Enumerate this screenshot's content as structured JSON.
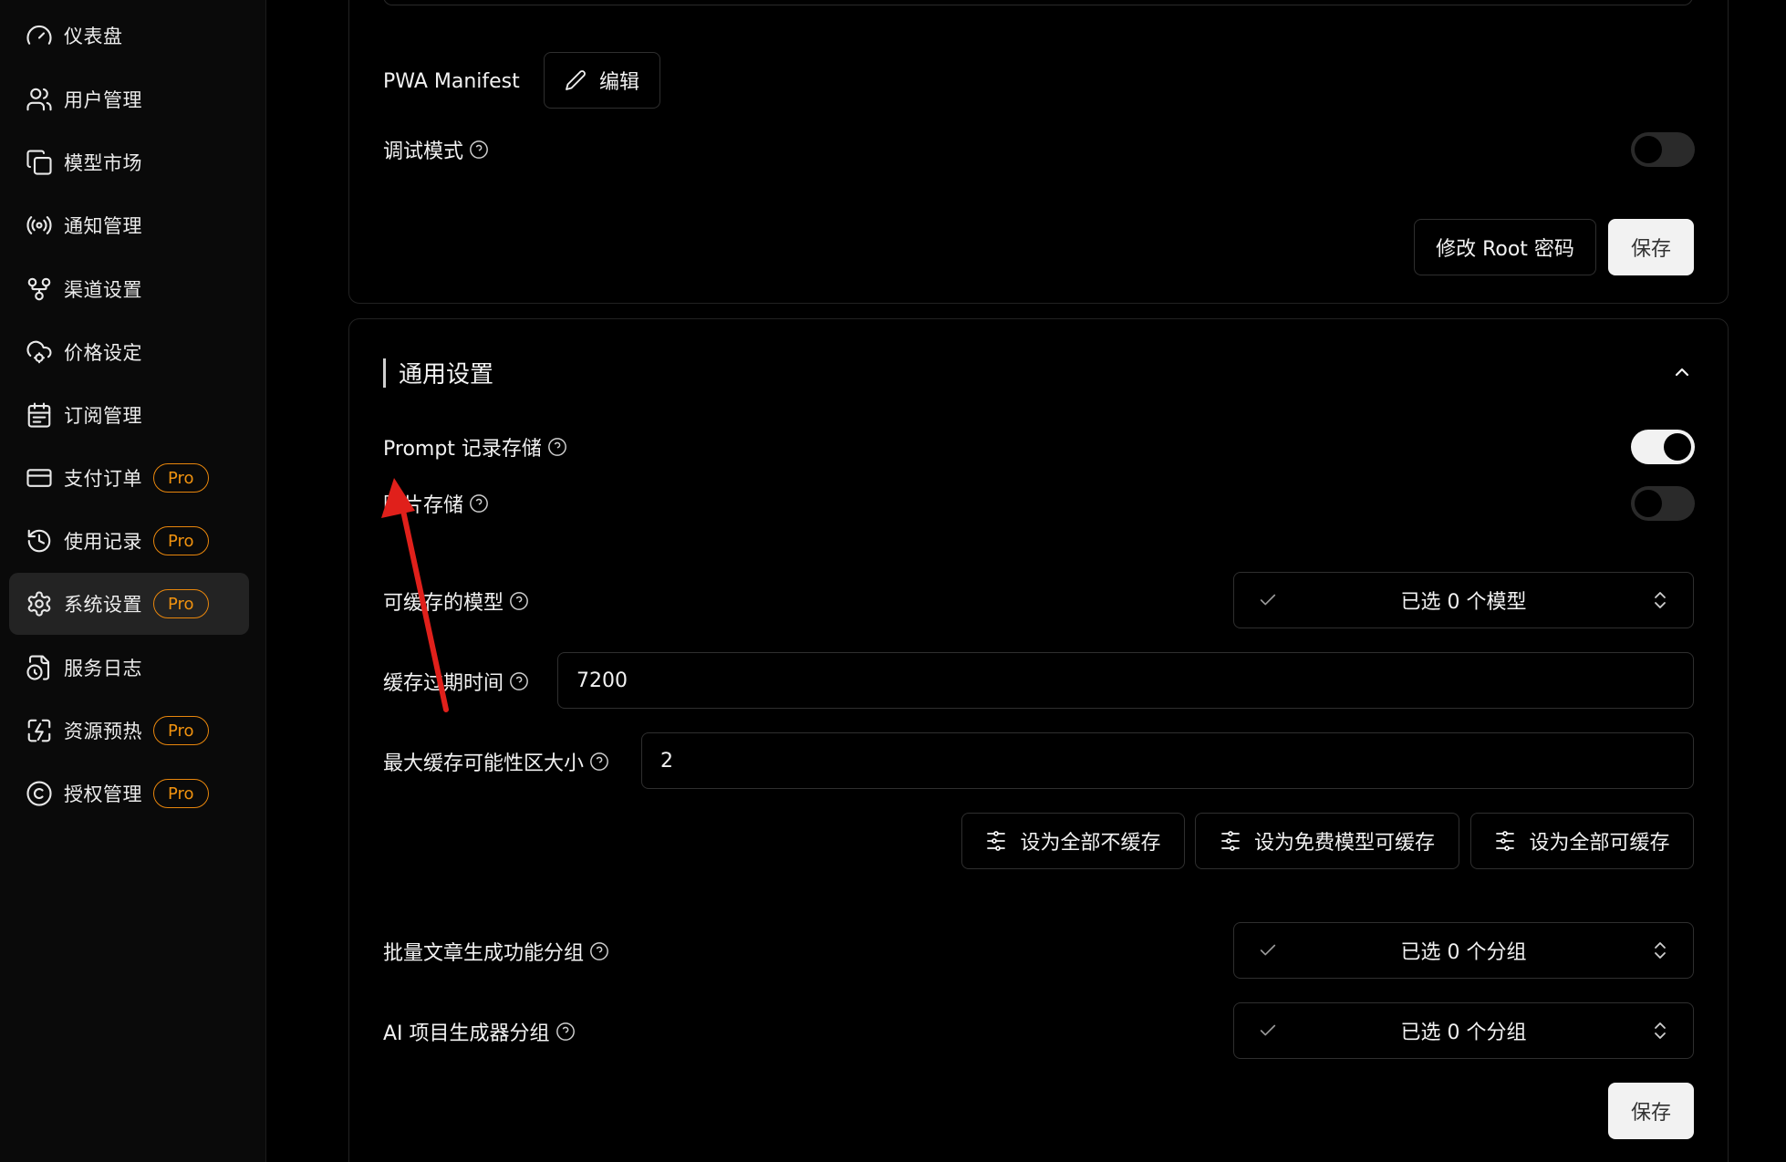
{
  "sidebar": {
    "items": [
      {
        "label": "仪表盘",
        "icon": "gauge-icon",
        "pro": false,
        "active": false
      },
      {
        "label": "用户管理",
        "icon": "users-icon",
        "pro": false,
        "active": false
      },
      {
        "label": "模型市场",
        "icon": "copy-icon",
        "pro": false,
        "active": false
      },
      {
        "label": "通知管理",
        "icon": "radio-icon",
        "pro": false,
        "active": false
      },
      {
        "label": "渠道设置",
        "icon": "git-fork-icon",
        "pro": false,
        "active": false
      },
      {
        "label": "价格设定",
        "icon": "cloud-cog-icon",
        "pro": false,
        "active": false
      },
      {
        "label": "订阅管理",
        "icon": "calendar-icon",
        "pro": false,
        "active": false
      },
      {
        "label": "支付订单",
        "icon": "credit-card-icon",
        "pro": true,
        "active": false
      },
      {
        "label": "使用记录",
        "icon": "history-icon",
        "pro": true,
        "active": false
      },
      {
        "label": "系统设置",
        "icon": "settings-icon",
        "pro": true,
        "active": true
      },
      {
        "label": "服务日志",
        "icon": "file-clock-icon",
        "pro": false,
        "active": false
      },
      {
        "label": "资源预热",
        "icon": "zap-box-icon",
        "pro": true,
        "active": false
      },
      {
        "label": "授权管理",
        "icon": "copyright-icon",
        "pro": true,
        "active": false
      }
    ],
    "pro_label": "Pro"
  },
  "top_card": {
    "pwa_label": "PWA Manifest",
    "edit_label": "编辑",
    "debug_label": "调试模式",
    "debug_on": false,
    "change_root_label": "修改 Root 密码",
    "save_label": "保存"
  },
  "general": {
    "title": "通用设置",
    "prompt_storage_label": "Prompt 记录存储",
    "prompt_storage_on": true,
    "image_storage_label": "图片存储",
    "image_storage_on": false,
    "cacheable_models_label": "可缓存的模型",
    "cacheable_models_value": "已选 0 个模型",
    "cache_ttl_label": "缓存过期时间",
    "cache_ttl_value": "7200",
    "max_cache_label": "最大缓存可能性区大小",
    "max_cache_value": "2",
    "set_none_label": "设为全部不缓存",
    "set_free_label": "设为免费模型可缓存",
    "set_all_label": "设为全部可缓存",
    "batch_group_label": "批量文章生成功能分组",
    "batch_group_value": "已选 0 个分组",
    "ai_group_label": "AI 项目生成器分组",
    "ai_group_value": "已选 0 个分组",
    "save_label": "保存"
  },
  "colors": {
    "accent_pro": "#e8860c",
    "annotation_arrow": "#e0201b"
  }
}
